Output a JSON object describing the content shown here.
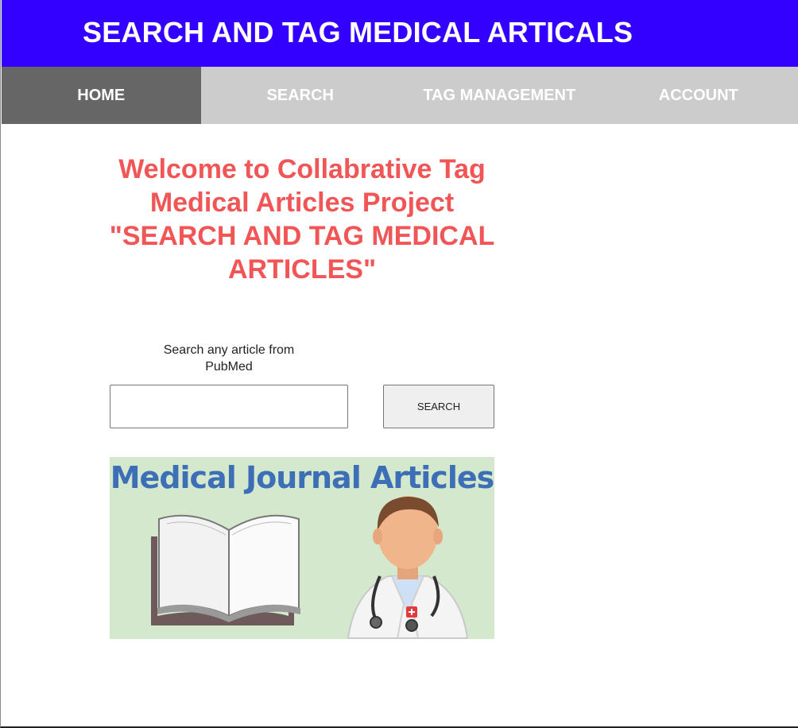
{
  "header": {
    "title": "SEARCH AND TAG MEDICAL ARTICALS"
  },
  "nav": {
    "items": [
      {
        "label": "HOME",
        "active": true
      },
      {
        "label": "SEARCH",
        "active": false
      },
      {
        "label": "TAG MANAGEMENT",
        "active": false
      },
      {
        "label": "ACCOUNT",
        "active": false
      }
    ]
  },
  "welcome": {
    "lines": [
      "Welcome to Collabrative Tag",
      "Medical Articles Project",
      "\"SEARCH AND TAG MEDICAL",
      "ARTICLES\""
    ]
  },
  "search": {
    "label_line1": "Search any article from",
    "label_line2": "PubMed",
    "value": "",
    "placeholder": "",
    "button_label": "SEARCH"
  },
  "banner_image": {
    "title": "Medical Journal Articles",
    "icons": [
      "open-book-icon",
      "doctor-icon"
    ]
  },
  "colors": {
    "header_bg": "#3300ff",
    "nav_bg": "#cccccc",
    "nav_active_bg": "#666666",
    "welcome_text": "#f15555",
    "image_bg": "#d3e8cc",
    "image_title": "#3d6fb6"
  }
}
